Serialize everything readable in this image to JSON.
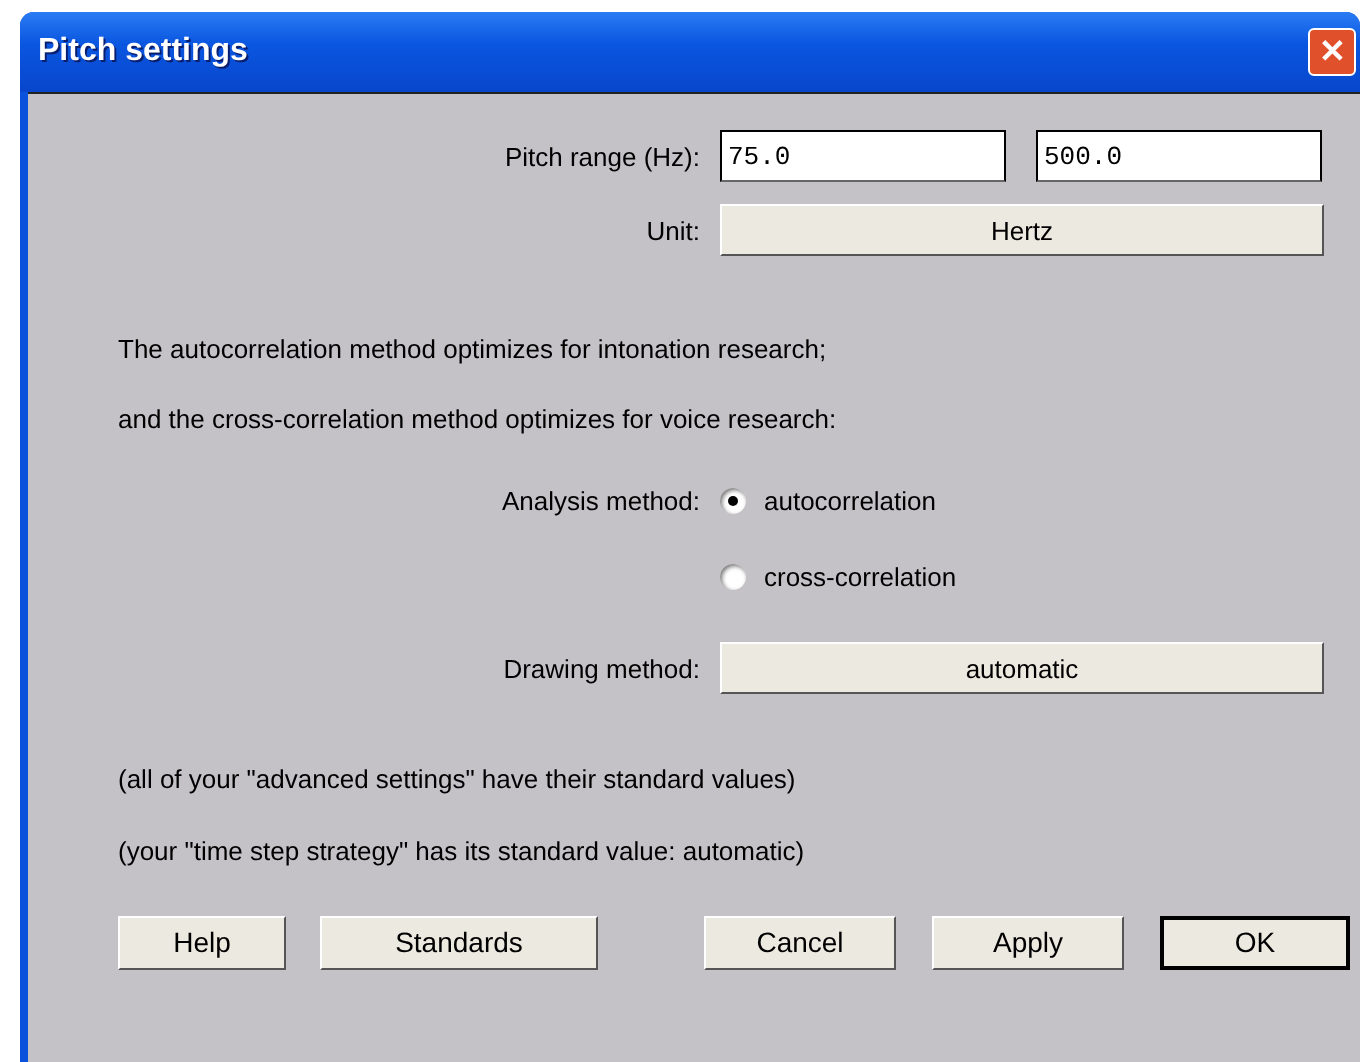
{
  "window": {
    "title": "Pitch settings",
    "close": "✕"
  },
  "pitch_range": {
    "label": "Pitch range (Hz):",
    "min": "75.0",
    "max": "500.0"
  },
  "unit": {
    "label": "Unit:",
    "value": "Hertz"
  },
  "notes": [
    "The autocorrelation method optimizes for intonation research;",
    "and the cross-correlation method optimizes for voice research:"
  ],
  "analysis_method": {
    "label": "Analysis method:",
    "options": [
      {
        "label": "autocorrelation",
        "selected": true
      },
      {
        "label": "cross-correlation",
        "selected": false
      }
    ]
  },
  "drawing_method": {
    "label": "Drawing method:",
    "value": "automatic"
  },
  "status_notes": [
    "(all of your \"advanced settings\" have their standard values)",
    "(your \"time step strategy\" has its standard value: automatic)"
  ],
  "buttons": [
    {
      "label": "Help",
      "default": false
    },
    {
      "label": "Standards",
      "default": false
    },
    {
      "label": "Cancel",
      "default": false
    },
    {
      "label": "Apply",
      "default": false
    },
    {
      "label": "OK",
      "default": true
    }
  ]
}
